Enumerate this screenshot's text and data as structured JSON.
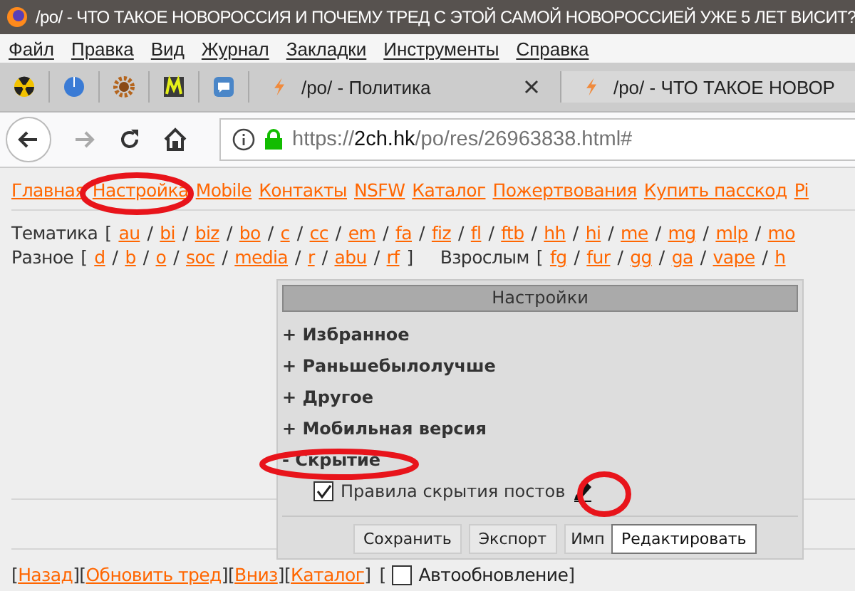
{
  "window": {
    "title": "/po/ - ЧТО ТАКОЕ НОВОРОССИЯ И ПОЧЕМУ ТРЕД С ЭТОЙ САМОЙ НОВОРОССИЕЙ УЖЕ 5 ЛЕТ ВИСИТ?"
  },
  "menu": [
    "Файл",
    "Правка",
    "Вид",
    "Журнал",
    "Закладки",
    "Инструменты",
    "Справка"
  ],
  "pinned_tabs": [
    {
      "kind": "radiation"
    },
    {
      "kind": "circle"
    },
    {
      "kind": "gear"
    },
    {
      "kind": "m-logo"
    },
    {
      "kind": "chat"
    }
  ],
  "tabs": [
    {
      "label": "/po/ - Политика",
      "selected": false,
      "closable": true
    },
    {
      "label": "/po/ - ЧТО ТАКОЕ НОВОР",
      "selected": true,
      "closable": false
    }
  ],
  "navbar": {
    "forward_disabled": true,
    "url": {
      "scheme": "https://",
      "host": "2ch.hk",
      "path": "/po/res/26963838.html#"
    }
  },
  "site_nav": [
    "Главная",
    "Настройка",
    "Mobile",
    "Контакты",
    "NSFW",
    "Каталог",
    "Пожертвования",
    "Купить пасскод",
    "Pi"
  ],
  "boards": [
    {
      "label": "Тематика",
      "bracket_open": "[",
      "separator": "/",
      "links": [
        "au",
        "bi",
        "biz",
        "bo",
        "c",
        "cc",
        "em",
        "fa",
        "fiz",
        "fl",
        "ftb",
        "hh",
        "hi",
        "me",
        "mg",
        "mlp",
        "mo"
      ]
    },
    {
      "label": "Разное",
      "bracket_open": "[",
      "separator": "/",
      "bracket_close": "]",
      "links": [
        "d",
        "b",
        "o",
        "soc",
        "media",
        "r",
        "abu",
        "rf"
      ]
    },
    {
      "label": "Взрослым",
      "bracket_open": "[",
      "separator": "/",
      "links": [
        "fg",
        "fur",
        "gg",
        "ga",
        "vape",
        "h"
      ]
    }
  ],
  "settings": {
    "title": "Настройки",
    "sections": [
      {
        "label": "+ Избранное"
      },
      {
        "label": "+ Раньшебылолучше"
      },
      {
        "label": "+ Другое"
      },
      {
        "label": "+ Мобильная версия"
      },
      {
        "label": "- Скрытие",
        "options": [
          {
            "label": "Правила скрытия постов",
            "checked": true
          }
        ]
      }
    ],
    "buttons": [
      "Сохранить",
      "Экспорт",
      "Имп"
    ],
    "tooltip": "Редактировать"
  },
  "bottom_nav": {
    "bracket_open": "[",
    "bracket_close": "]",
    "links": [
      "Назад",
      "Обновить тред",
      "Вниз",
      "Каталог"
    ],
    "autoupdate": {
      "label": "Автообновление",
      "checked": false
    }
  }
}
